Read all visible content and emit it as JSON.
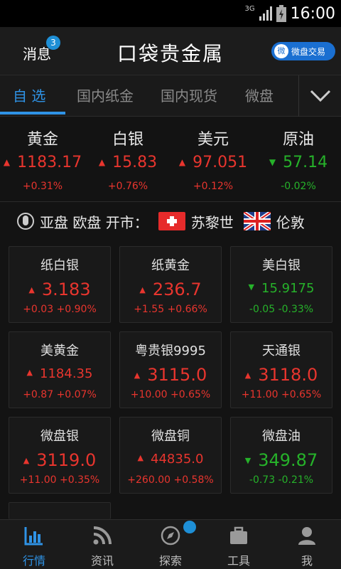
{
  "status_bar": {
    "network": "3G",
    "time": "16:00"
  },
  "header": {
    "messages_label": "消息",
    "messages_badge": "3",
    "title": "口袋贵金属",
    "trade_button": "微盘交易",
    "trade_icon_text": "微"
  },
  "tabs": [
    {
      "label": "自 选",
      "active": true
    },
    {
      "label": "国内纸金",
      "active": false
    },
    {
      "label": "国内现货",
      "active": false
    },
    {
      "label": "微盘",
      "active": false
    }
  ],
  "quotes": [
    {
      "name": "黄金",
      "value": "1183.17",
      "change": "+0.31%",
      "trend": "up"
    },
    {
      "name": "白银",
      "value": "15.83",
      "change": "+0.76%",
      "trend": "up"
    },
    {
      "name": "美元",
      "value": "97.051",
      "change": "+0.12%",
      "trend": "up"
    },
    {
      "name": "原油",
      "value": "57.14",
      "change": "-0.02%",
      "trend": "down"
    }
  ],
  "market_session": {
    "label": "亚盘 欧盘 开市：",
    "city1": "苏黎世",
    "city2": "伦敦"
  },
  "grid": [
    {
      "name": "纸白银",
      "price": "3.183",
      "change": "+0.03",
      "pct": "+0.90%",
      "trend": "up"
    },
    {
      "name": "纸黄金",
      "price": "236.7",
      "change": "+1.55",
      "pct": "+0.66%",
      "trend": "up"
    },
    {
      "name": "美白银",
      "price": "15.9175",
      "change": "-0.05",
      "pct": "-0.33%",
      "trend": "down"
    },
    {
      "name": "美黄金",
      "price": "1184.35",
      "change": "+0.87",
      "pct": "+0.07%",
      "trend": "up"
    },
    {
      "name": "粤贵银9995",
      "price": "3115.0",
      "change": "+10.00",
      "pct": "+0.65%",
      "trend": "up"
    },
    {
      "name": "天通银",
      "price": "3118.0",
      "change": "+11.00",
      "pct": "+0.65%",
      "trend": "up"
    },
    {
      "name": "微盘银",
      "price": "3119.0",
      "change": "+11.00",
      "pct": "+0.35%",
      "trend": "up"
    },
    {
      "name": "微盘铜",
      "price": "44835.0",
      "change": "+260.00",
      "pct": "+0.58%",
      "trend": "up"
    },
    {
      "name": "微盘油",
      "price": "349.87",
      "change": "-0.73",
      "pct": "-0.21%",
      "trend": "down"
    }
  ],
  "bottom_nav": [
    {
      "label": "行情",
      "icon": "bar-chart-icon",
      "active": true
    },
    {
      "label": "资讯",
      "icon": "rss-icon",
      "active": false
    },
    {
      "label": "探索",
      "icon": "compass-icon",
      "active": false
    },
    {
      "label": "工具",
      "icon": "toolbox-icon",
      "active": false
    },
    {
      "label": "我",
      "icon": "user-icon",
      "active": false
    }
  ],
  "colors": {
    "up": "#e8352e",
    "down": "#26b22a",
    "accent": "#2f93e6"
  }
}
